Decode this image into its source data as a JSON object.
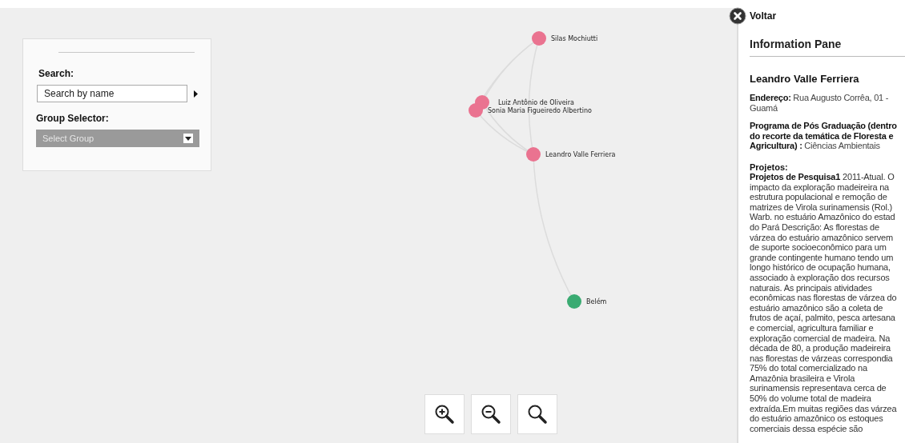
{
  "search_panel": {
    "search_label": "Search:",
    "search": {
      "placeholder": "Search by name"
    },
    "group_label": "Group Selector:",
    "group_select": {
      "value": "Select Group"
    }
  },
  "graph": {
    "nodes": [
      {
        "label": "Silas Mochiutti",
        "color": "#ea7390"
      },
      {
        "label": "Luiz Antônio de Oliveira",
        "color": "#ea7390"
      },
      {
        "label": "Sonia Maria Figueiredo Albertino",
        "color": "#ea7390"
      },
      {
        "label": "Leandro  Valle Ferriera",
        "color": "#ea7390"
      },
      {
        "label": "Belém",
        "color": "#3aab72"
      }
    ]
  },
  "zoom_controls": [
    {
      "kind": "zoom-in"
    },
    {
      "kind": "zoom-out"
    },
    {
      "kind": "reset"
    }
  ],
  "info_pane": {
    "back_label": "Voltar",
    "title": "Information Pane",
    "name": "Leandro Valle Ferriera",
    "fields": [
      "**Endereço:** Rua Augusto Corrêa, 01 - Guamá",
      "**Programa de Pós Graduação (dentro do recorte da temática de Floresta e Agricultura) :** Ciências Ambientais"
    ],
    "projects_heading": "Projetos:",
    "projects_lines": [
      "**Projetos de Pesquisa1** 2011-Atual. O",
      "impacto da exploração madeireira na",
      "estrutura populacional e remoção de",
      "matrizes de Virola surinamensis (Rol.)",
      "Warb. no estuário Amazônico do estad",
      "do Pará Descrição: As florestas de",
      "várzea do estuário amazônico servem",
      "de suporte socioeconômico para um",
      "grande contingente humano tendo um",
      "longo histórico de ocupação humana,",
      "associado à exploração dos recursos",
      "naturais. As principais atividades",
      "econômicas nas florestas de várzea do",
      "estuário amazônico são a coleta de",
      "frutos de açaí, palmito, pesca artesana",
      "e comercial, agricultura familiar e",
      "exploração comercial de madeira. Na",
      "década de 80, a produção madeireira",
      "nas florestas de várzeas correspondia",
      "75% do total comercializado na",
      "Amazônia brasileira e Virola",
      "surinamensis representava cerca de",
      "50% do volume total de madeira",
      "extraída.Em muitas regiões das várzea",
      "do estuário amazônico os estoques",
      "comerciais dessa espécie são"
    ]
  }
}
